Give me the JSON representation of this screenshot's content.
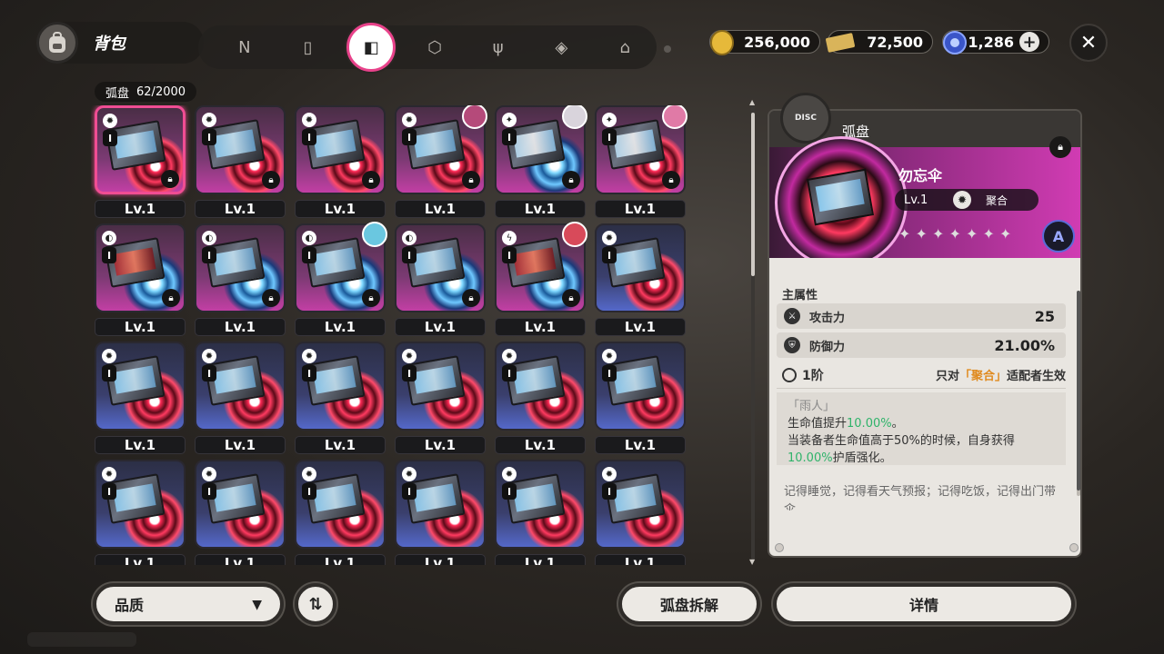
{
  "header": {
    "title": "背包",
    "tabs": [
      {
        "icon": "n-logo-icon",
        "glyph": "N",
        "active": false
      },
      {
        "icon": "gameboy-icon",
        "glyph": "▯",
        "active": false
      },
      {
        "icon": "drive-disc-icon",
        "glyph": "◧",
        "active": true
      },
      {
        "icon": "cube-icon",
        "glyph": "⬡",
        "active": false
      },
      {
        "icon": "fork-knife-icon",
        "glyph": "ψ",
        "active": false
      },
      {
        "icon": "ticket-icon",
        "glyph": "◈",
        "active": false
      },
      {
        "icon": "home-icon",
        "glyph": "⌂",
        "active": false
      }
    ],
    "currencies": [
      {
        "icon": "dennies-coin-icon",
        "value": "256,000",
        "color": "#e6b93a"
      },
      {
        "icon": "film-ticket-icon",
        "value": "72,500",
        "color": "#d9b45a"
      },
      {
        "icon": "polychrome-icon",
        "value": "1,286",
        "color": "#4b6bd8"
      }
    ],
    "plus_label": "+",
    "close_label": "✕"
  },
  "inventory": {
    "count_label": "弧盘",
    "count_value": "62/2000",
    "level_label": "Lv.1",
    "items": [
      {
        "rank": "S",
        "art": "normal",
        "ring": "red",
        "lock": true,
        "avatar": null,
        "selected": true,
        "badge": "✹"
      },
      {
        "rank": "S",
        "art": "normal",
        "ring": "red",
        "lock": true,
        "avatar": null,
        "selected": false,
        "badge": "✹"
      },
      {
        "rank": "S",
        "art": "normal",
        "ring": "red",
        "lock": true,
        "avatar": null,
        "selected": false,
        "badge": "✹"
      },
      {
        "rank": "S",
        "art": "normal",
        "ring": "red",
        "lock": true,
        "avatar": "#b54a7a",
        "selected": false,
        "badge": "✹"
      },
      {
        "rank": "S",
        "art": "ice",
        "ring": "blue",
        "lock": true,
        "avatar": "#d9d4dc",
        "selected": false,
        "badge": "✦"
      },
      {
        "rank": "S",
        "art": "ice",
        "ring": "red",
        "lock": true,
        "avatar": "#e07aa6",
        "selected": false,
        "badge": "✦"
      },
      {
        "rank": "S",
        "art": "red",
        "ring": "blue",
        "lock": true,
        "avatar": null,
        "selected": false,
        "badge": "◐"
      },
      {
        "rank": "S",
        "art": "normal",
        "ring": "blue",
        "lock": true,
        "avatar": null,
        "selected": false,
        "badge": "◐"
      },
      {
        "rank": "S",
        "art": "normal",
        "ring": "blue",
        "lock": true,
        "avatar": "#6ac7e0",
        "selected": false,
        "badge": "◐"
      },
      {
        "rank": "S",
        "art": "normal",
        "ring": "blue",
        "lock": true,
        "avatar": null,
        "selected": false,
        "badge": "◐"
      },
      {
        "rank": "S",
        "art": "red",
        "ring": "blue",
        "lock": true,
        "avatar": "#d84a5a",
        "selected": false,
        "badge": "ϟ"
      },
      {
        "rank": "A",
        "art": "normal",
        "ring": "red",
        "lock": false,
        "avatar": null,
        "selected": false,
        "badge": "✹"
      },
      {
        "rank": "A",
        "art": "normal",
        "ring": "red",
        "lock": false,
        "avatar": null,
        "selected": false,
        "badge": "✹"
      },
      {
        "rank": "A",
        "art": "normal",
        "ring": "red",
        "lock": false,
        "avatar": null,
        "selected": false,
        "badge": "✹"
      },
      {
        "rank": "A",
        "art": "normal",
        "ring": "red",
        "lock": false,
        "avatar": null,
        "selected": false,
        "badge": "✹"
      },
      {
        "rank": "A",
        "art": "normal",
        "ring": "red",
        "lock": false,
        "avatar": null,
        "selected": false,
        "badge": "✹"
      },
      {
        "rank": "A",
        "art": "normal",
        "ring": "red",
        "lock": false,
        "avatar": null,
        "selected": false,
        "badge": "✹"
      },
      {
        "rank": "A",
        "art": "normal",
        "ring": "red",
        "lock": false,
        "avatar": null,
        "selected": false,
        "badge": "✹"
      },
      {
        "rank": "A",
        "art": "normal",
        "ring": "red",
        "lock": false,
        "avatar": null,
        "selected": false,
        "badge": "✹"
      },
      {
        "rank": "A",
        "art": "normal",
        "ring": "red",
        "lock": false,
        "avatar": null,
        "selected": false,
        "badge": "✹"
      },
      {
        "rank": "A",
        "art": "normal",
        "ring": "red",
        "lock": false,
        "avatar": null,
        "selected": false,
        "badge": "✹"
      },
      {
        "rank": "A",
        "art": "normal",
        "ring": "red",
        "lock": false,
        "avatar": null,
        "selected": false,
        "badge": "✹"
      },
      {
        "rank": "A",
        "art": "normal",
        "ring": "red",
        "lock": false,
        "avatar": null,
        "selected": false,
        "badge": "✹"
      },
      {
        "rank": "A",
        "art": "normal",
        "ring": "red",
        "lock": false,
        "avatar": null,
        "selected": false,
        "badge": "✹"
      }
    ]
  },
  "detail": {
    "category": "弧盘",
    "emblem_text": "DISC",
    "name": "勿忘伞",
    "level": "Lv.1",
    "tag": "聚合",
    "rank": "A",
    "stars": "✦ ✦ ✦ ✦ ✦ ✦ ✦",
    "main_stats_title": "主属性",
    "stats": [
      {
        "icon": "attack-icon",
        "glyph": "⚔",
        "name": "攻击力",
        "value": "25"
      },
      {
        "icon": "defense-icon",
        "glyph": "⛨",
        "name": "防御力",
        "value": "21.00%"
      }
    ],
    "tier": {
      "name": "1阶",
      "cond_prefix": "只对",
      "cond_highlight": "「聚合」",
      "cond_suffix": "适配者生效"
    },
    "effect": {
      "quote": "「雨人」",
      "line1_prefix": "生命值提升",
      "line1_value": "10.00%",
      "line1_suffix": "。",
      "line2": "当装备者生命值高于50%的时候，自身获得",
      "line3_value": "10.00%",
      "line3_suffix": "护盾强化。"
    },
    "flavor": "记得睡觉，记得看天气预报；记得吃饭，记得出门带伞"
  },
  "footer": {
    "sort_label": "品质",
    "sort_caret": "▼",
    "order_glyph": "⇅",
    "dismantle_label": "弧盘拆解",
    "detail_label": "详情"
  }
}
